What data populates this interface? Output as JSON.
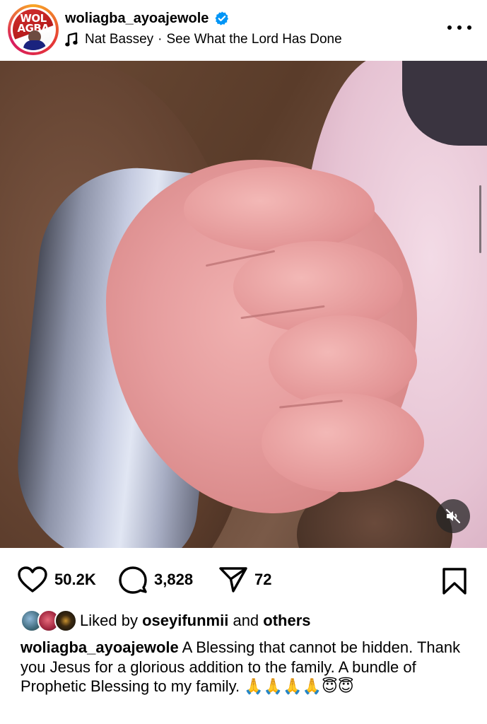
{
  "header": {
    "username": "woliagba_ayoajewole",
    "verified": true,
    "avatar_logo_text": "WOL\nAGBA",
    "music": {
      "icon": "music-note-icon",
      "artist": "Nat Bassey",
      "separator": "·",
      "song": "See What the Lord Has Done"
    },
    "more_icon": "more-options-icon"
  },
  "media": {
    "type": "video",
    "audio_state": "muted",
    "mute_icon": "speaker-muted-icon"
  },
  "actions": {
    "likes": "50.2K",
    "comments": "3,828",
    "shares": "72",
    "icons": [
      "heart-icon",
      "comment-icon",
      "share-icon",
      "bookmark-icon"
    ]
  },
  "liked_by": {
    "prefix": "Liked by",
    "user": "oseyifunmii",
    "conjunction": "and",
    "others": "others"
  },
  "caption": {
    "username": "woliagba_ayoajewole",
    "text": "A Blessing that cannot be hidden. Thank you Jesus for a glorious addition to the family. A bundle of Prophetic Blessing to my family.",
    "emojis": "🙏🙏🙏🙏😇😇"
  },
  "colors": {
    "verified": "#0095f6",
    "text": "#000000",
    "background": "#ffffff"
  }
}
